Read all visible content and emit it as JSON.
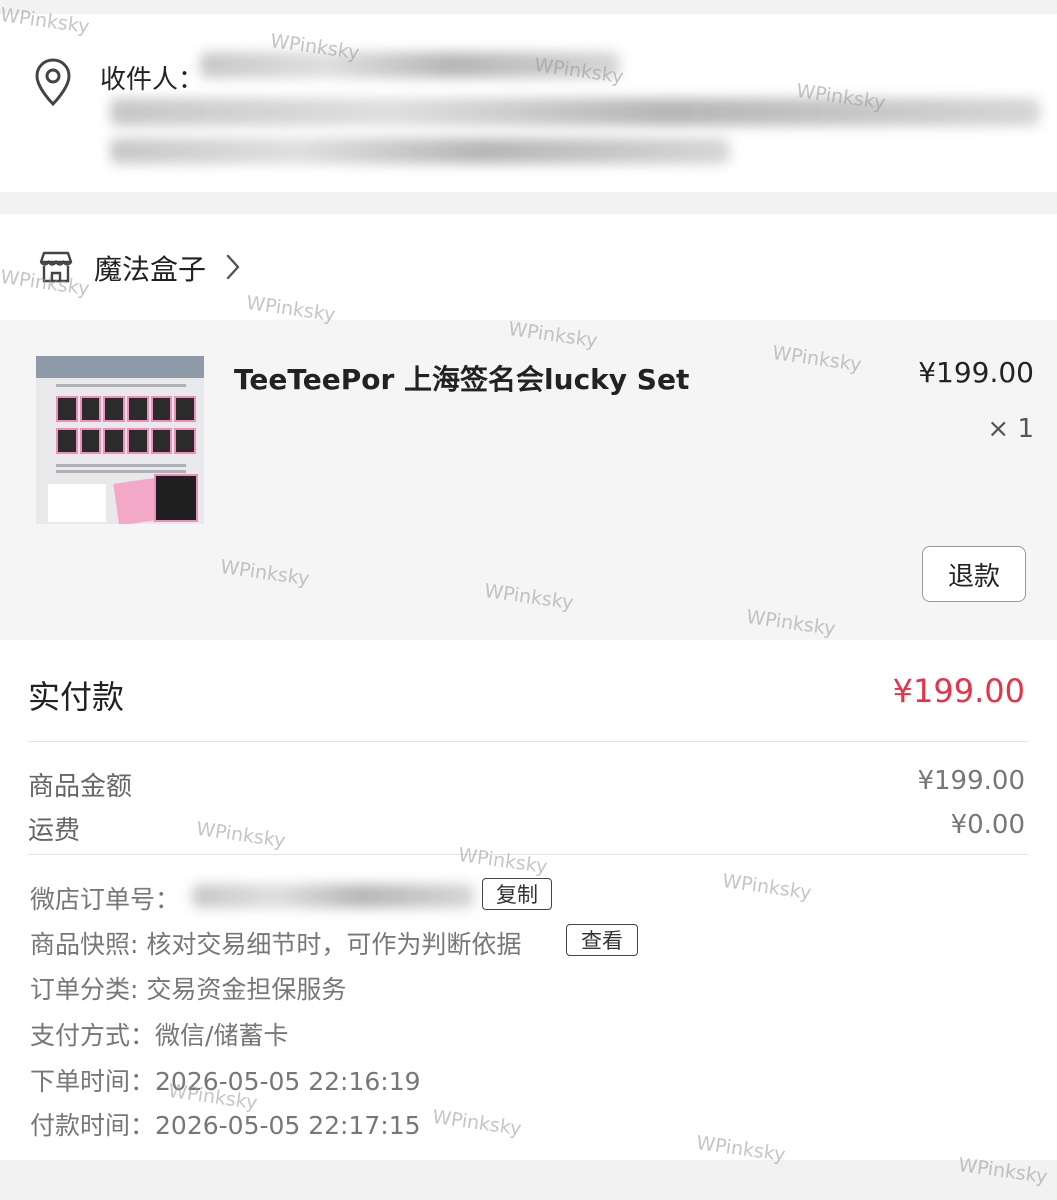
{
  "recipient": {
    "label": "收件人："
  },
  "store": {
    "name": "魔法盒子",
    "icon": "store-icon"
  },
  "product": {
    "title": "TeeTeePor 上海签名会lucky Set",
    "price": "¥199.00",
    "quantity": "× 1",
    "refund_label": "退款"
  },
  "summary": {
    "paid_label": "实付款",
    "paid_value": "¥199.00",
    "goods_label": "商品金额",
    "goods_value": "¥199.00",
    "shipping_label": "运费",
    "shipping_value": "¥0.00"
  },
  "order_info": {
    "order_no_label": "微店订单号：",
    "copy_label": "复制",
    "snapshot_label": "商品快照: ",
    "snapshot_text": "核对交易细节时，可作为判断依据",
    "view_label": "查看",
    "category_label": "订单分类: ",
    "category_value": "交易资金担保服务",
    "payment_label": "支付方式：",
    "payment_value": "微信/储蓄卡",
    "order_time_label": "下单时间：",
    "order_time_value": "2026-05-05 22:16:19",
    "pay_time_label": "付款时间：",
    "pay_time_value": "2026-05-05 22:17:15"
  },
  "watermark": {
    "text": "WPinksky"
  },
  "colors": {
    "accent": "#e8324a",
    "background": "#f2f2f2"
  }
}
